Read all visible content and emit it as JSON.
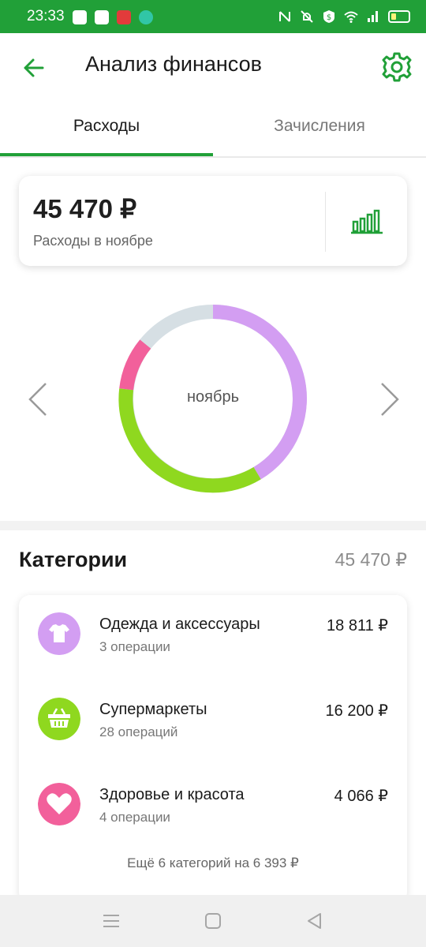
{
  "status_bar": {
    "time": "23:33",
    "background": "#21a038"
  },
  "app_bar": {
    "title": "Анализ финансов"
  },
  "tabs": [
    {
      "label": "Расходы",
      "active": true
    },
    {
      "label": "Зачисления",
      "active": false
    }
  ],
  "summary": {
    "amount": "45 470 ₽",
    "subtitle": "Расходы в ноябре"
  },
  "donut": {
    "center_label": "ноябрь"
  },
  "categories": {
    "title": "Категории",
    "total": "45 470 ₽",
    "items": [
      {
        "name": "Одежда и аксессуары",
        "ops": "3 операции",
        "amount": "18 811 ₽",
        "color": "#d39ef2",
        "icon": "tshirt-icon"
      },
      {
        "name": "Супермаркеты",
        "ops": "28 операций",
        "amount": "16 200 ₽",
        "color": "#8fd81f",
        "icon": "basket-icon"
      },
      {
        "name": "Здоровье и красота",
        "ops": "4 операции",
        "amount": "4 066 ₽",
        "color": "#f2609b",
        "icon": "heart-icon"
      }
    ],
    "more": "Ещё 6 категорий на 6 393 ₽"
  },
  "colors": {
    "accent": "#21a038",
    "clothes": "#d39ef2",
    "supermarkets": "#8fd81f",
    "health": "#f2609b",
    "other": "#d6dfe4"
  }
}
